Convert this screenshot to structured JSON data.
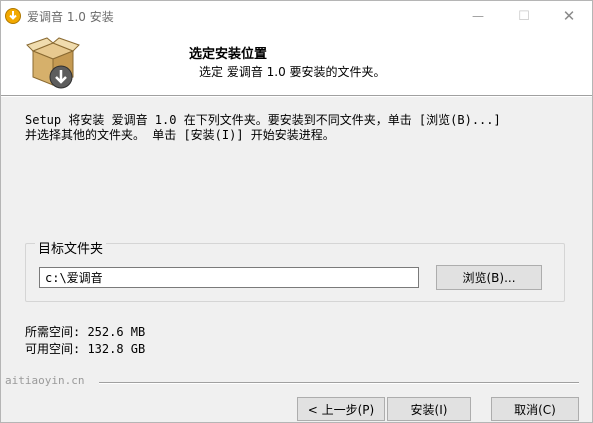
{
  "window": {
    "title": "爱调音 1.0 安装",
    "minimize": "—",
    "maximize": "☐",
    "close": "✕"
  },
  "header": {
    "title": "选定安装位置",
    "subtitle": "选定 爱调音 1.0 要安装的文件夹。",
    "icon": "installer-box-icon"
  },
  "description": {
    "line1": "Setup 将安装 爱调音 1.0 在下列文件夹。要安装到不同文件夹，单击 [浏览(B)...]",
    "line2": "并选择其他的文件夹。 单击 [安装(I)] 开始安装进程。"
  },
  "destination": {
    "group_label": "目标文件夹",
    "path_value": "c:\\爱调音",
    "browse_label": "浏览(B)..."
  },
  "space": {
    "required": "所需空间: 252.6 MB",
    "available": "可用空间: 132.8 GB"
  },
  "branding": "aitiaoyin.cn",
  "buttons": {
    "back": "< 上一步(P)",
    "install": "安装(I)",
    "cancel": "取消(C)"
  }
}
